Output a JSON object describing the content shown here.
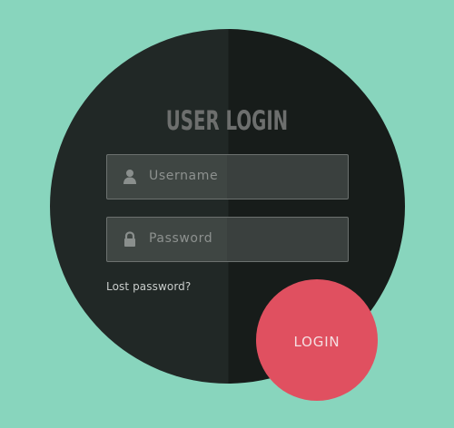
{
  "title": "USER LOGIN",
  "form": {
    "username_placeholder": "Username",
    "password_placeholder": "Password",
    "lost_password": "Lost password?",
    "login_button": "LOGIN"
  },
  "icons": {
    "username": "user-icon",
    "password": "lock-icon"
  },
  "colors": {
    "background": "#88d5bd",
    "panel_left": "#212826",
    "panel_right": "#171c1a",
    "field": "#3f4643",
    "field_border": "#6c716f",
    "muted_text": "#8d918f",
    "accent": "#e95364"
  }
}
